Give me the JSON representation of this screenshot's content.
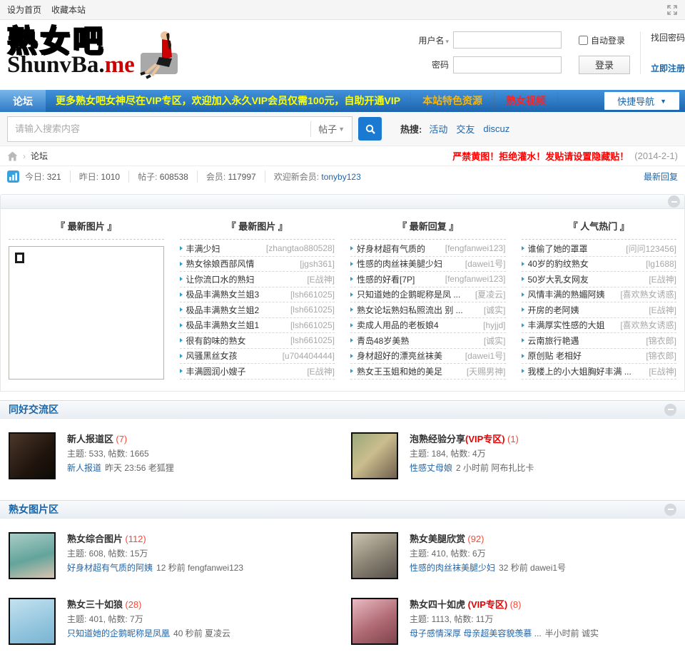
{
  "topbar": {
    "set_home": "设为首页",
    "bookmark": "收藏本站"
  },
  "header": {
    "logo": {
      "cn": "熟女吧",
      "en_black": "ShunvBa.",
      "en_red": "me"
    },
    "login": {
      "username_label": "用户名",
      "password_label": "密码",
      "auto_login": "自动登录",
      "login_button": "登录",
      "forgot": "找回密码",
      "register": "立即注册"
    }
  },
  "nav": {
    "forum_tab": "论坛",
    "notice": "更多熟女吧女神尽在VIP专区，欢迎加入永久VIP会员仅需100元，自助开通VIP",
    "featured_link": "本站特色资源",
    "video_link": "熟女视频",
    "quick_nav": "快捷导航"
  },
  "searchbar": {
    "placeholder": "请输入搜索内容",
    "scope": "帖子",
    "hot_label": "热搜:",
    "hot1": "活动",
    "hot2": "交友",
    "hot3": "discuz"
  },
  "breadcrumb": {
    "forum": "论坛",
    "warning": "严禁黄图！拒绝灌水！发贴请设置隐藏贴！",
    "date": "(2014-2-1)"
  },
  "stats": {
    "today_label": "今日:",
    "today": "321",
    "yesterday_label": "昨日:",
    "yesterday": "1010",
    "posts_label": "帖子:",
    "posts": "608538",
    "members_label": "会员:",
    "members": "117997",
    "welcome_label": "欢迎新会员:",
    "newest_member": "tonyby123",
    "latest_reply": "最新回复"
  },
  "panel": {
    "col1_title": "『 最新图片 』",
    "col2_title": "『 最新图片 』",
    "col3_title": "『 最新回复 』",
    "col4_title": "『 人气热门 』",
    "col2_items": [
      {
        "t": "丰满少妇",
        "u": "[zhangtao880528]"
      },
      {
        "t": "熟女徐娘西部风情",
        "u": "[jgsh361]"
      },
      {
        "t": "让你流口水的熟妇",
        "u": "[E战神]"
      },
      {
        "t": "极品丰满熟女兰姐3",
        "u": "[lsh661025]"
      },
      {
        "t": "极品丰满熟女兰姐2",
        "u": "[lsh661025]"
      },
      {
        "t": "极品丰满熟女兰姐1",
        "u": "[lsh661025]"
      },
      {
        "t": "很有韵味的熟女",
        "u": "[lsh661025]"
      },
      {
        "t": "风骚黑丝女孩",
        "u": "[u704404444]"
      },
      {
        "t": "丰满圆润小嫂子",
        "u": "[E战神]"
      }
    ],
    "col3_items": [
      {
        "t": "好身材超有气质的",
        "u": "[fengfanwei123]"
      },
      {
        "t": "性感的肉丝袜美腿少妇",
        "u": "[dawei1号]"
      },
      {
        "t": "性感的好看[7P]",
        "u": "[fengfanwei123]"
      },
      {
        "t": "只知道她的企鹅昵称是凤 ...",
        "u": "[夏凌云]"
      },
      {
        "t": "熟女论坛熟妇私照流出 别 ...",
        "u": "[诚实]"
      },
      {
        "t": "卖成人用品的老板娘4",
        "u": "[hyjjd]"
      },
      {
        "t": "青岛48岁美熟",
        "u": "[诚实]"
      },
      {
        "t": "身材超好的漂亮丝袜美",
        "u": "[dawei1号]"
      },
      {
        "t": "熟女王玉姐和她的美足",
        "u": "[天赐男神]"
      }
    ],
    "col4_items": [
      {
        "t": "谁偷了她的罩罩",
        "u": "[问问123456]"
      },
      {
        "t": "40岁的豹纹熟女",
        "u": "[lg1688]"
      },
      {
        "t": "50岁大乳女网友",
        "u": "[E战神]"
      },
      {
        "t": "风情丰满的熟媚阿姨",
        "u": "[喜欢熟女诱惑]"
      },
      {
        "t": "开房的老阿姨",
        "u": "[E战神]"
      },
      {
        "t": "丰满厚实性感的大姐",
        "u": "[喜欢熟女诱惑]"
      },
      {
        "t": "云南旅行艳遇",
        "u": "[锦衣郎]"
      },
      {
        "t": "原创贴 老相好",
        "u": "[锦衣郎]"
      },
      {
        "t": "我楼上的小大姐胸好丰满 ...",
        "u": "[E战神]"
      }
    ]
  },
  "sections": [
    {
      "title": "同好交流区",
      "forums": [
        {
          "title": "新人报道区",
          "vip": "",
          "count": "(7)",
          "stats": "主题: 533, 帖数: 1665",
          "last_link": "新人报道",
          "last_meta": "昨天 23:56 老狐狸"
        },
        {
          "title": "泡熟经验分享",
          "vip": "(VIP专区)",
          "count": "(1)",
          "stats": "主题: 184, 帖数: 4万",
          "last_link": "性感丈母娘",
          "last_meta": "2 小时前 阿布扎比卡"
        }
      ]
    },
    {
      "title": "熟女图片区",
      "forums": [
        {
          "title": "熟女综合图片",
          "vip": "",
          "count": "(112)",
          "stats": "主题: 608, 帖数: 15万",
          "last_link": "好身材超有气质的阿姨",
          "last_meta": "12 秒前 fengfanwei123"
        },
        {
          "title": "熟女美腿欣赏",
          "vip": "",
          "count": "(92)",
          "stats": "主题: 410, 帖数: 6万",
          "last_link": "性感的肉丝袜美腿少妇",
          "last_meta": "32 秒前 dawei1号"
        },
        {
          "title": "熟女三十如狼",
          "vip": "",
          "count": "(28)",
          "stats": "主题: 401, 帖数: 7万",
          "last_link": "只知道她的企鹅昵称是凤凰",
          "last_meta": "40 秒前 夏凌云"
        },
        {
          "title": "熟女四十如虎 ",
          "vip": "(VIP专区)",
          "count": "(8)",
          "stats": "主题: 1113, 帖数: 11万",
          "last_link": "母子感情深厚 母亲超美容貌羡慕 ...",
          "last_meta": "半小时前 诚实"
        }
      ]
    }
  ]
}
